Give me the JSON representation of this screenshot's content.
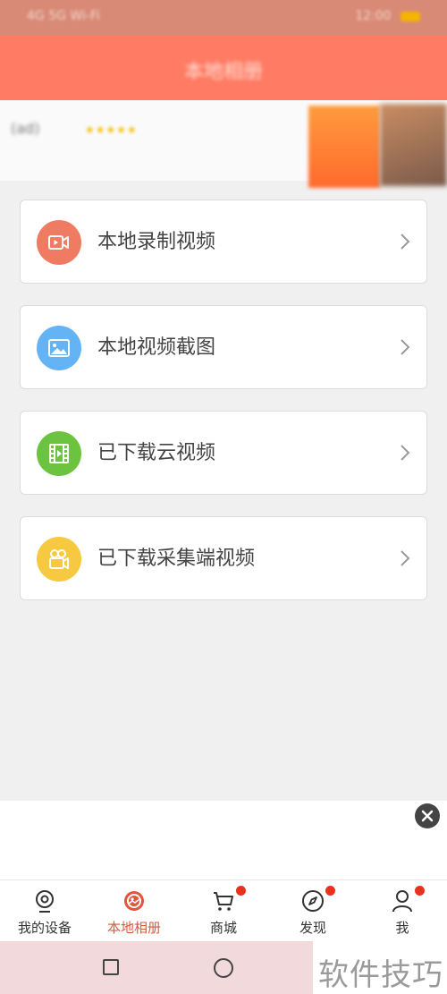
{
  "status_bar": {
    "left_text": "4G 5G Wi-Fi",
    "right_text": "12:00"
  },
  "header": {
    "title": "本地相册"
  },
  "banner": {
    "title": "(ad)",
    "stars": "★★★★★",
    "subtitle": ""
  },
  "cards": [
    {
      "label": "本地录制视频",
      "icon": "video-camera-icon",
      "color": "#ef7b63"
    },
    {
      "label": "本地视频截图",
      "icon": "image-icon",
      "color": "#63b3f5"
    },
    {
      "label": "已下载云视频",
      "icon": "film-icon",
      "color": "#6cc33f"
    },
    {
      "label": "已下载采集端视频",
      "icon": "movie-camera-icon",
      "color": "#f6c940"
    }
  ],
  "bottom_nav": [
    {
      "label": "我的设备",
      "icon": "webcam-icon",
      "active": false,
      "badge": false
    },
    {
      "label": "本地相册",
      "icon": "album-icon",
      "active": true,
      "badge": false
    },
    {
      "label": "商城",
      "icon": "cart-icon",
      "active": false,
      "badge": true
    },
    {
      "label": "发现",
      "icon": "compass-icon",
      "active": false,
      "badge": true
    },
    {
      "label": "我",
      "icon": "person-icon",
      "active": false,
      "badge": true
    }
  ],
  "watermark": {
    "text": "软件技巧"
  },
  "colors": {
    "header": "#ff7b63",
    "active_nav": "#e0553d",
    "badge": "#e8321e"
  }
}
